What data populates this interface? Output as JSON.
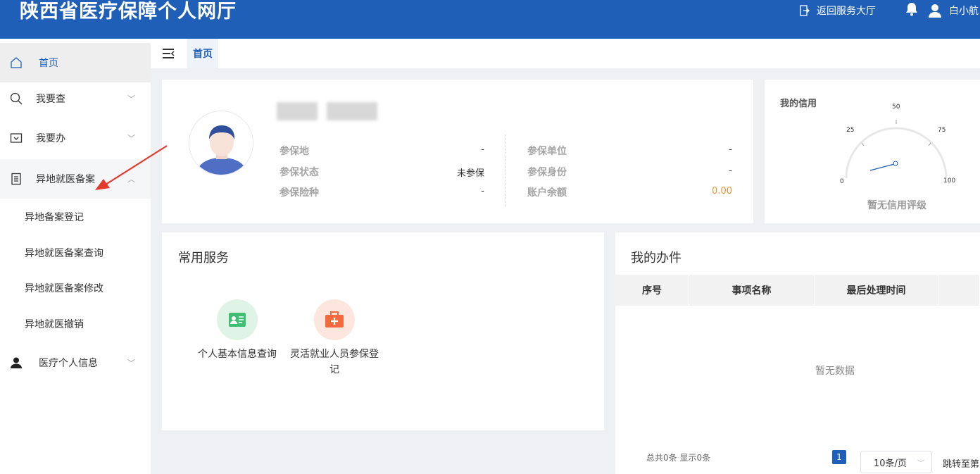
{
  "header": {
    "title": "陕西省医疗保障个人网厅",
    "back_link": "返回服务大厅",
    "user_name": "白小航",
    "bg_color": "#1f5fb8",
    "icons": [
      "exit-icon",
      "bell-icon",
      "user-icon"
    ]
  },
  "sidebar": {
    "home": "首页",
    "items": [
      {
        "label": "我要查",
        "icon": "search-icon",
        "expanded": false
      },
      {
        "label": "我要办",
        "icon": "inbox-icon",
        "expanded": false
      },
      {
        "label": "异地就医备案",
        "icon": "document-icon",
        "expanded": true
      },
      {
        "label": "医疗个人信息",
        "icon": "person-icon",
        "expanded": false
      }
    ],
    "sub_items": [
      "异地备案登记",
      "异地就医备案查询",
      "异地就医备案修改",
      "异地就医撤销"
    ]
  },
  "tabs": {
    "active": "首页"
  },
  "profile": {
    "left": [
      {
        "label": "参保地",
        "value": "-"
      },
      {
        "label": "参保状态",
        "value": "未参保"
      },
      {
        "label": "参保险种",
        "value": "-"
      }
    ],
    "right": [
      {
        "label": "参保单位",
        "value": "-"
      },
      {
        "label": "参保身份",
        "value": "-"
      },
      {
        "label": "账户余额",
        "value": "0.00"
      }
    ]
  },
  "credit": {
    "title": "我的信用",
    "status": "暂无信用评级",
    "gauge_ticks": [
      "0",
      "25",
      "50",
      "75",
      "100"
    ]
  },
  "services": {
    "title": "常用服务",
    "items": [
      {
        "label": "个人基本信息查询",
        "icon": "id-card-icon",
        "color": "#dff4e6"
      },
      {
        "label": "灵活就业人员参保登记",
        "icon": "medical-kit-icon",
        "color": "#fde6dd"
      }
    ]
  },
  "tasks": {
    "title": "我的办件",
    "columns": [
      "序号",
      "事项名称",
      "最后处理时间"
    ],
    "empty_text": "暂无数据",
    "total_text": "总共0条 显示0条",
    "current_page": "1",
    "page_size": "10条/页",
    "jump_label": "跳转至第"
  }
}
